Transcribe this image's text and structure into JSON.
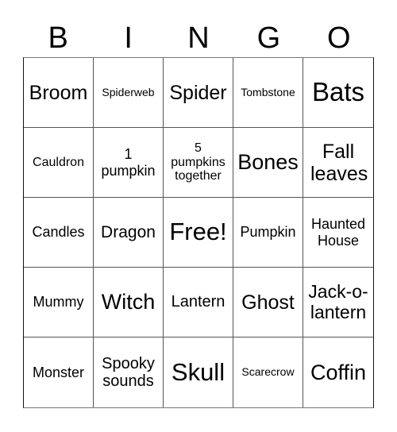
{
  "header": [
    "B",
    "I",
    "N",
    "G",
    "O"
  ],
  "cells": [
    [
      "Broom",
      "Spiderweb",
      "Spider",
      "Tombstone",
      "Bats"
    ],
    [
      "Cauldron",
      "1 pumpkin",
      "5 pumpkins together",
      "Bones",
      "Fall leaves"
    ],
    [
      "Candles",
      "Dragon",
      "Free!",
      "Pumpkin",
      "Haunted House"
    ],
    [
      "Mummy",
      "Witch",
      "Lantern",
      "Ghost",
      "Jack-o-lantern"
    ],
    [
      "Monster",
      "Spooky sounds",
      "Skull",
      "Scarecrow",
      "Coffin"
    ]
  ]
}
